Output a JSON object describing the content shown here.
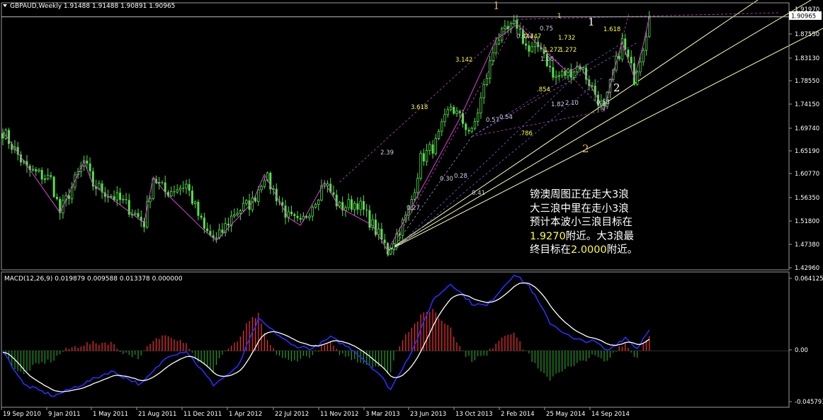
{
  "chart_data": [
    {
      "type": "candlestick",
      "header": {
        "symbol": "GBPAUD,Weekly",
        "ohlc": [
          "1.91488",
          "1.91488",
          "1.90891",
          "1.90965"
        ]
      },
      "last_price": "1.90965",
      "ylim": [
        1.4125,
        1.9375
      ],
      "y_ticks": [
        "1.91970",
        "1.87550",
        "1.83130",
        "1.78550",
        "1.74150",
        "1.69740",
        "1.65190",
        "1.60770",
        "1.56350",
        "1.51800",
        "1.47380",
        "1.42960"
      ],
      "x_ticks": [
        "19 Sep 2010",
        "9 Jan 2011",
        "1 May 2011",
        "21 Aug 2011",
        "11 Dec 2011",
        "1 Apr 2012",
        "22 Jul 2012",
        "11 Nov 2012",
        "3 Mar 2013",
        "23 Jun 2013",
        "13 Oct 2013",
        "2 Feb 2014",
        "25 May 2014",
        "14 Sep 2014"
      ],
      "close_anchors": [
        {
          "date": "2010-09-19",
          "close": 1.685
        },
        {
          "date": "2010-11-14",
          "close": 1.61
        },
        {
          "date": "2011-01-09",
          "close": 1.59
        },
        {
          "date": "2011-01-30",
          "close": 1.525
        },
        {
          "date": "2011-03-27",
          "close": 1.625
        },
        {
          "date": "2011-04-17",
          "close": 1.58
        },
        {
          "date": "2011-06-26",
          "close": 1.545
        },
        {
          "date": "2011-08-14",
          "close": 1.505
        },
        {
          "date": "2011-09-04",
          "close": 1.595
        },
        {
          "date": "2011-10-02",
          "close": 1.565
        },
        {
          "date": "2011-11-20",
          "close": 1.58
        },
        {
          "date": "2012-01-01",
          "close": 1.49
        },
        {
          "date": "2012-01-29",
          "close": 1.47
        },
        {
          "date": "2012-03-11",
          "close": 1.525
        },
        {
          "date": "2012-04-22",
          "close": 1.545
        },
        {
          "date": "2012-05-20",
          "close": 1.6
        },
        {
          "date": "2012-07-15",
          "close": 1.515
        },
        {
          "date": "2012-08-12",
          "close": 1.5
        },
        {
          "date": "2012-10-07",
          "close": 1.585
        },
        {
          "date": "2012-11-11",
          "close": 1.535
        },
        {
          "date": "2012-12-23",
          "close": 1.545
        },
        {
          "date": "2013-01-27",
          "close": 1.5
        },
        {
          "date": "2013-02-24",
          "close": 1.46
        },
        {
          "date": "2013-03-03",
          "close": 1.45
        },
        {
          "date": "2013-04-21",
          "close": 1.525
        },
        {
          "date": "2013-05-19",
          "close": 1.63
        },
        {
          "date": "2013-06-23",
          "close": 1.66
        },
        {
          "date": "2013-07-28",
          "close": 1.735
        },
        {
          "date": "2013-08-18",
          "close": 1.71
        },
        {
          "date": "2013-09-15",
          "close": 1.68
        },
        {
          "date": "2013-10-13",
          "close": 1.77
        },
        {
          "date": "2013-11-10",
          "close": 1.865
        },
        {
          "date": "2013-12-29",
          "close": 1.895
        },
        {
          "date": "2014-01-26",
          "close": 1.84
        },
        {
          "date": "2014-02-23",
          "close": 1.855
        },
        {
          "date": "2014-03-23",
          "close": 1.79
        },
        {
          "date": "2014-04-27",
          "close": 1.8
        },
        {
          "date": "2014-05-25",
          "close": 1.815
        },
        {
          "date": "2014-06-22",
          "close": 1.77
        },
        {
          "date": "2014-07-20",
          "close": 1.725
        },
        {
          "date": "2014-08-10",
          "close": 1.8
        },
        {
          "date": "2014-08-31",
          "close": 1.86
        },
        {
          "date": "2014-09-28",
          "close": 1.79
        },
        {
          "date": "2014-10-19",
          "close": 1.855
        },
        {
          "date": "2014-11-02",
          "close": 1.91
        }
      ],
      "fib_labels": [
        {
          "text": "1",
          "color": "#ffff33"
        },
        {
          "text": "0.75",
          "color": "#cfcfe6"
        },
        {
          "text": "0.447",
          "color": "#cfcfe6"
        },
        {
          "text": "0.447",
          "color": "#ffff33"
        },
        {
          "text": "1.618",
          "color": "#ffff33"
        },
        {
          "text": "1.732",
          "color": "#ffff33"
        },
        {
          "text": "1.272",
          "color": "#ffff33"
        },
        {
          "text": "1.272",
          "color": "#ffff33"
        },
        {
          "text": "1.06",
          "color": "#cfcfe6"
        },
        {
          "text": "3.142",
          "color": "#ffff33"
        },
        {
          "text": "3.618",
          "color": "#ffff33"
        },
        {
          "text": ".854",
          "color": "#ffff33"
        },
        {
          "text": "1.82",
          "color": "#cfcfe6"
        },
        {
          "text": "2.10",
          "color": "#cfcfe6"
        },
        {
          "text": "0.57",
          "color": "#cfcfe6"
        },
        {
          "text": "0.54",
          "color": "#cfcfe6"
        },
        {
          "text": ".786",
          "color": "#ffff33"
        },
        {
          "text": "0.58",
          "color": "#cfcfe6"
        },
        {
          "text": "2.39",
          "color": "#cfcfe6"
        },
        {
          "text": "0.30",
          "color": "#cfcfe6"
        },
        {
          "text": "0.28",
          "color": "#cfcfe6"
        },
        {
          "text": "0.41",
          "color": "#cfcfe6"
        },
        {
          "text": "0.27",
          "color": "#cfcfe6"
        }
      ],
      "wave_labels": [
        {
          "text": "1",
          "color": "#e0b050"
        },
        {
          "text": "2",
          "color": "#e0b050"
        },
        {
          "text": "1",
          "color": "#ffffff"
        },
        {
          "text": "2",
          "color": "#ffffff"
        }
      ],
      "annotation_lines": [
        {
          "segments": [
            {
              "text": "镑澳周图正在走大3浪"
            }
          ]
        },
        {
          "segments": [
            {
              "text": "大三浪中里在走小3浪"
            }
          ]
        },
        {
          "segments": [
            {
              "text": "预计本波小三浪目标在"
            }
          ]
        },
        {
          "segments": [
            {
              "text": "1.9270",
              "highlight": true
            },
            {
              "text": "附近。大3浪最"
            }
          ]
        },
        {
          "segments": [
            {
              "text": "终目标在"
            },
            {
              "text": "2.0000",
              "highlight": true
            },
            {
              "text": "附近。"
            }
          ]
        }
      ],
      "colors": {
        "candle": "#55e04a",
        "zigzag": "#e040e0",
        "trendline": "#ffffb0",
        "fib_yellow": "#ffff33",
        "fib_grey": "#cfcfe6"
      }
    },
    {
      "type": "macd",
      "header": "MACD(12,26,9) 0.019879 0.009588 0.013378 0.000000",
      "ylim": [
        -0.05,
        0.07
      ],
      "y_ticks": [
        "0.064125",
        "0.00",
        "-0.045793"
      ],
      "macd_anchors": [
        {
          "date": "2010-09-19",
          "v": 0.0
        },
        {
          "date": "2010-11-07",
          "v": -0.03
        },
        {
          "date": "2011-01-16",
          "v": -0.04
        },
        {
          "date": "2011-03-20",
          "v": -0.03
        },
        {
          "date": "2011-05-29",
          "v": -0.018
        },
        {
          "date": "2011-08-07",
          "v": -0.03
        },
        {
          "date": "2011-10-09",
          "v": -0.004
        },
        {
          "date": "2011-11-20",
          "v": 0.0
        },
        {
          "date": "2012-01-22",
          "v": -0.03
        },
        {
          "date": "2012-03-18",
          "v": -0.015
        },
        {
          "date": "2012-05-06",
          "v": 0.028
        },
        {
          "date": "2012-07-22",
          "v": 0.005
        },
        {
          "date": "2012-09-09",
          "v": 0.002
        },
        {
          "date": "2012-10-21",
          "v": 0.012
        },
        {
          "date": "2012-12-16",
          "v": 0.0
        },
        {
          "date": "2013-02-10",
          "v": -0.02
        },
        {
          "date": "2013-03-10",
          "v": -0.034
        },
        {
          "date": "2013-05-05",
          "v": 0.005
        },
        {
          "date": "2013-06-16",
          "v": 0.045
        },
        {
          "date": "2013-07-28",
          "v": 0.06
        },
        {
          "date": "2013-09-15",
          "v": 0.042
        },
        {
          "date": "2013-10-20",
          "v": 0.04
        },
        {
          "date": "2013-12-22",
          "v": 0.068
        },
        {
          "date": "2014-01-26",
          "v": 0.058
        },
        {
          "date": "2014-03-16",
          "v": 0.025
        },
        {
          "date": "2014-05-11",
          "v": 0.01
        },
        {
          "date": "2014-06-29",
          "v": 0.008
        },
        {
          "date": "2014-07-27",
          "v": 0.0
        },
        {
          "date": "2014-09-07",
          "v": 0.012
        },
        {
          "date": "2014-10-05",
          "v": 0.002
        },
        {
          "date": "2014-11-02",
          "v": 0.02
        }
      ],
      "colors": {
        "macd": "#2a2cff",
        "signal": "#ffffff",
        "hist_pos": "#ff3030",
        "hist_neg": "#20a020"
      }
    }
  ]
}
